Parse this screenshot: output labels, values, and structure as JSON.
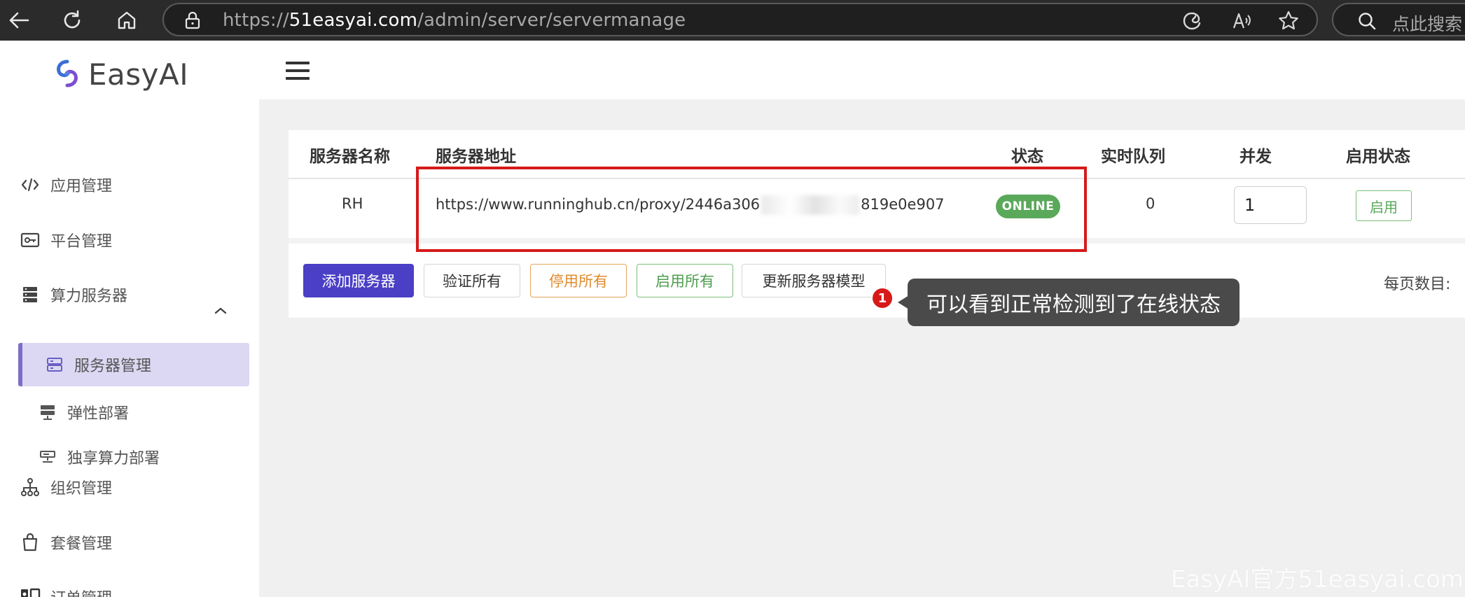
{
  "browser": {
    "url_prefix": "https://",
    "url_host": "51easyai.com",
    "url_path": "/admin/server/servermanage",
    "search_placeholder": "点此搜索"
  },
  "sidebar": {
    "logo_text": "EasyAI",
    "items": [
      {
        "label": "应用管理",
        "icon": "app-code-icon"
      },
      {
        "label": "平台管理",
        "icon": "platform-key-icon"
      },
      {
        "label": "算力服务器",
        "icon": "server-stack-icon",
        "expanded": true
      },
      {
        "label": "组织管理",
        "icon": "org-tree-icon"
      },
      {
        "label": "套餐管理",
        "icon": "package-bag-icon"
      },
      {
        "label": "订单管理",
        "icon": "order-user-icon"
      }
    ],
    "sub_items": [
      {
        "label": "服务器管理",
        "icon": "server-list-icon",
        "active": true
      },
      {
        "label": "弹性部署",
        "icon": "elastic-server-icon"
      },
      {
        "label": "独享算力部署",
        "icon": "dedicated-server-icon"
      }
    ]
  },
  "table": {
    "headers": [
      "服务器名称",
      "服务器地址",
      "状态",
      "实时队列",
      "并发",
      "启用状态"
    ],
    "rows": [
      {
        "name": "RH",
        "address_start": "https://www.runninghub.cn/proxy/2446a306",
        "address_end": "819e0e907",
        "status": "ONLINE",
        "queue": "0",
        "concurrency": "1",
        "enable_label": "启用"
      }
    ]
  },
  "actions": {
    "add": "添加服务器",
    "verify_all": "验证所有",
    "disable_all": "停用所有",
    "enable_all": "启用所有",
    "update_models": "更新服务器模型",
    "page_size_label": "每页数目:"
  },
  "annotation": {
    "number": "1",
    "text": "可以看到正常检测到了在线状态"
  },
  "watermark": "EasyAI官方51easyai.com",
  "colors": {
    "primary": "#4a3fc5",
    "online": "#5aa85a",
    "highlight": "#d61a1a",
    "warn": "#e08a2d"
  }
}
